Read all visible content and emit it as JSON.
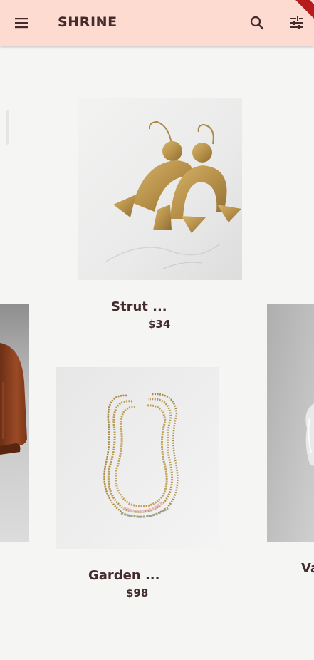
{
  "app": {
    "title": "SHRINE"
  },
  "icons": {
    "menu": "menu-icon",
    "search": "search-icon",
    "filter": "tune-icon"
  },
  "colors": {
    "appbar": "#fedbd0",
    "text": "#442b2d",
    "background": "#f5f6f4"
  },
  "products": [
    {
      "name": "Strut ...",
      "price": "$34",
      "image": "brass-earrings"
    },
    {
      "name": "Garden ...",
      "price": "$98",
      "image": "beaded-necklace"
    },
    {
      "name": "Va",
      "price": "",
      "image": "glass-vase"
    },
    {
      "name": "",
      "price": "",
      "image": "leather-belt"
    }
  ]
}
